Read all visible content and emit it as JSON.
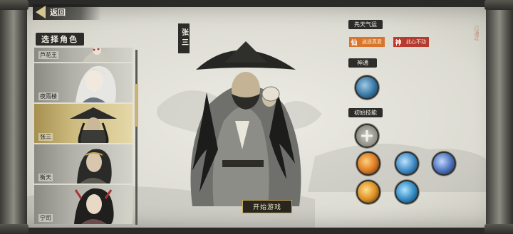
{
  "nav": {
    "back_label": "返回"
  },
  "left_panel": {
    "title": "选择角色",
    "characters": [
      {
        "name": "芦花王",
        "state": "partial"
      },
      {
        "name": "夜雨楼",
        "state": "normal"
      },
      {
        "name": "张三",
        "state": "selected"
      },
      {
        "name": "衡天",
        "state": "normal"
      },
      {
        "name": "宁司",
        "state": "partial"
      }
    ]
  },
  "hero": {
    "name": "张三",
    "start_button": "开始游戏"
  },
  "right_panel": {
    "innate_label": "先天气运",
    "traits": [
      {
        "glyph": "仙",
        "text": "逍遥真君",
        "color": "#d9742c"
      },
      {
        "glyph": "神",
        "text": "此心不动",
        "color": "#c0392b"
      }
    ],
    "divine_label": "神通",
    "skills_label": "初始技能",
    "skill_icons": [
      "swirl-icon",
      "add-icon",
      "fire-slash-icon",
      "water-dash-icon",
      "ice-strike-icon",
      "lightning-claw-icon",
      "wave-icon"
    ]
  },
  "stamp_text": "已通过"
}
